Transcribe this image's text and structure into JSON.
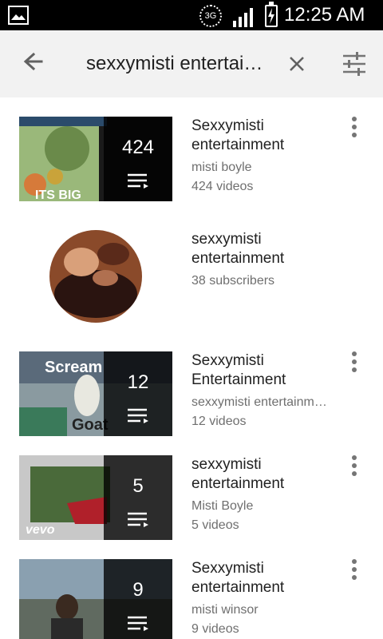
{
  "status_bar": {
    "network_label": "3G",
    "time": "12:25 AM",
    "icons": [
      "image-icon",
      "3g-icon",
      "signal-icon",
      "battery-charging-icon"
    ]
  },
  "toolbar": {
    "search_query": "sexxymisti entertainment",
    "back_icon": "arrow-back-icon",
    "clear_icon": "close-icon",
    "filter_icon": "tune-icon"
  },
  "results": [
    {
      "type": "playlist",
      "count": "424",
      "title": "Sexxymisti entertainment",
      "owner": "misti boyle",
      "meta": "424 videos",
      "thumb_text": "ITS BIG"
    },
    {
      "type": "channel",
      "title": "sexxymisti entertainment",
      "meta": "38 subscribers"
    },
    {
      "type": "playlist",
      "count": "12",
      "title": "Sexxymisti Entertainment",
      "owner": "sexxymisti entertainment",
      "meta": "12 videos",
      "thumb_text_top": "Scream",
      "thumb_text_bottom": "Goat"
    },
    {
      "type": "playlist",
      "count": "5",
      "title": "sexxymisti entertainment",
      "owner": "Misti Boyle",
      "meta": "5 videos",
      "thumb_text": "vevo"
    },
    {
      "type": "playlist",
      "count": "9",
      "title": "Sexxymisti entertainment",
      "owner": "misti winsor",
      "meta": "9 videos"
    }
  ],
  "colors": {
    "status_bar": "#000000",
    "toolbar_bg": "#f2f2f2",
    "title_text": "#212121",
    "secondary_text": "#6f6f6f"
  }
}
